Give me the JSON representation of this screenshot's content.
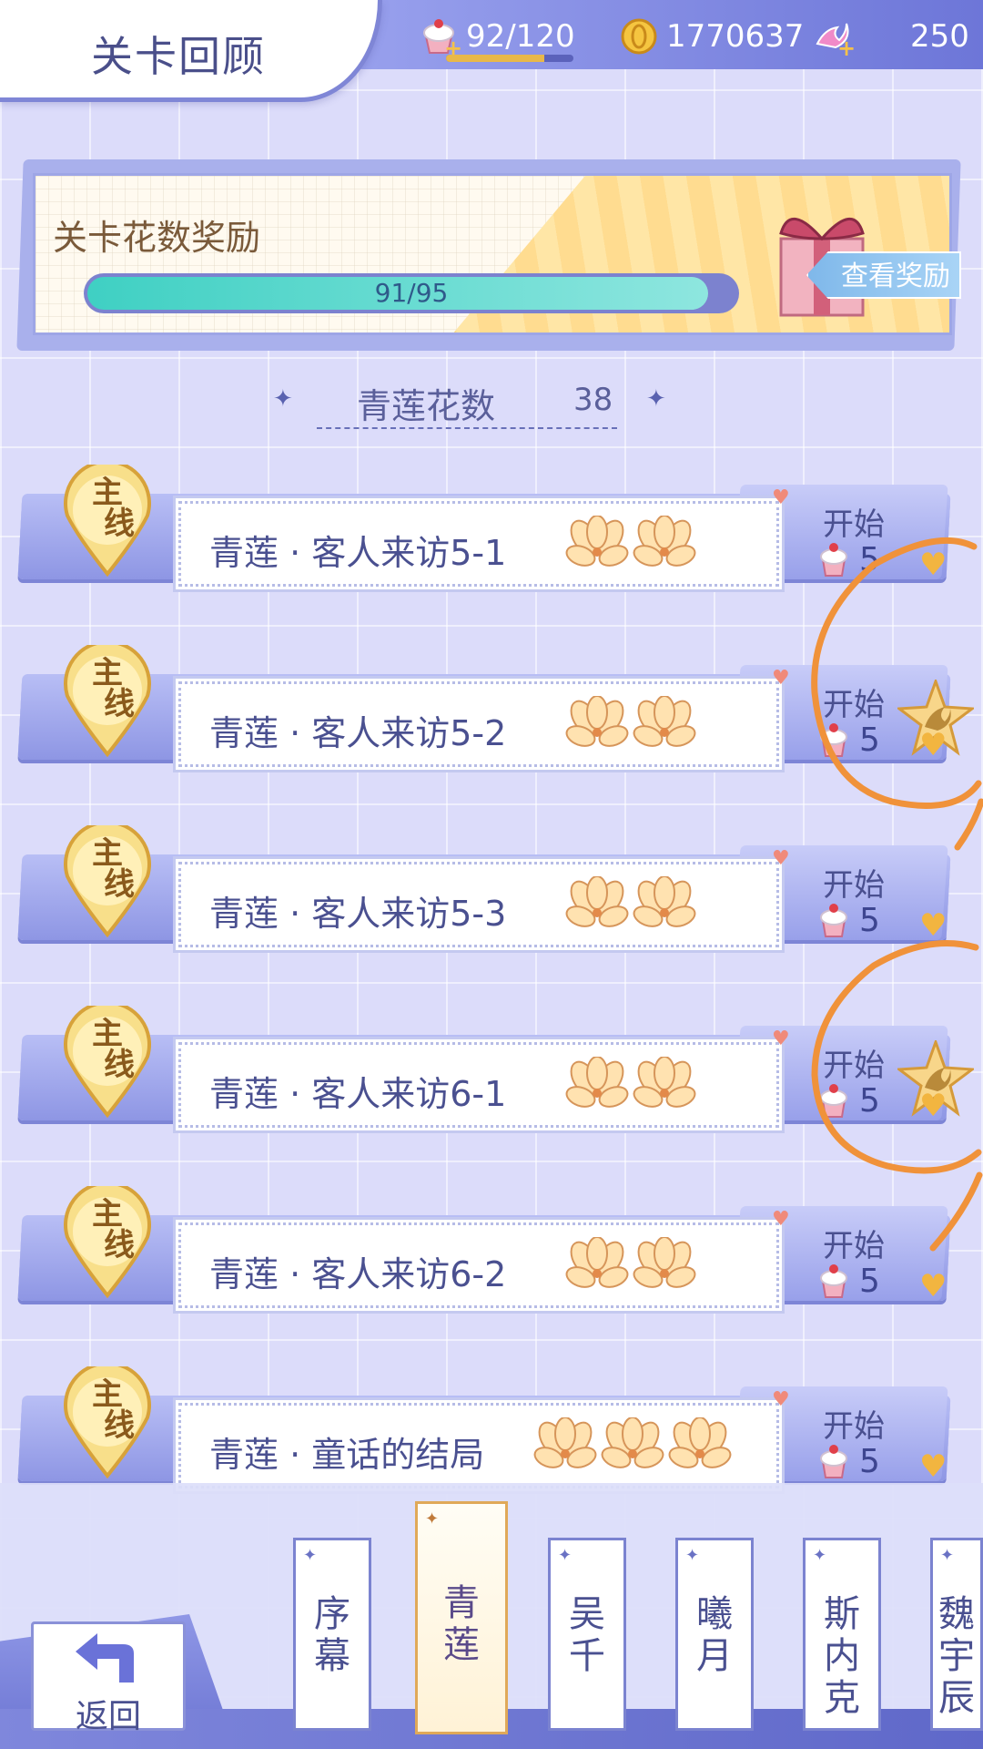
{
  "header": {
    "title": "关卡回顾",
    "resources": {
      "stamina": "92/120",
      "stamina_fraction": 0.77,
      "gold": "1770637",
      "gems": "250"
    }
  },
  "reward": {
    "title": "关卡花数奖励",
    "progress_text": "91/95",
    "progress_fraction": 0.958,
    "view_button": "查看奖励"
  },
  "flower_count": {
    "label": "青莲花数",
    "value": "38"
  },
  "levels": [
    {
      "badge_top": "主",
      "badge_bottom": "线",
      "name": "青莲 · 客人来访5-1",
      "flowers": 2,
      "start": "开始",
      "cost": "5",
      "star": false
    },
    {
      "badge_top": "主",
      "badge_bottom": "线",
      "name": "青莲 · 客人来访5-2",
      "flowers": 2,
      "start": "开始",
      "cost": "5",
      "star": true
    },
    {
      "badge_top": "主",
      "badge_bottom": "线",
      "name": "青莲 · 客人来访5-3",
      "flowers": 2,
      "start": "开始",
      "cost": "5",
      "star": false
    },
    {
      "badge_top": "主",
      "badge_bottom": "线",
      "name": "青莲 · 客人来访6-1",
      "flowers": 2,
      "start": "开始",
      "cost": "5",
      "star": true
    },
    {
      "badge_top": "主",
      "badge_bottom": "线",
      "name": "青莲 · 客人来访6-2",
      "flowers": 2,
      "start": "开始",
      "cost": "5",
      "star": false
    },
    {
      "badge_top": "主",
      "badge_bottom": "线",
      "name": "青莲 · 童话的结局",
      "flowers": 3,
      "start": "开始",
      "cost": "5",
      "star": false
    }
  ],
  "bottom": {
    "back_label": "返回",
    "chapters": [
      {
        "label": "序幕",
        "active": false
      },
      {
        "label": "青莲",
        "active": true
      },
      {
        "label": "吴千",
        "active": false
      },
      {
        "label": "曦月",
        "active": false
      },
      {
        "label": "斯内克",
        "active": false
      },
      {
        "label": "魏宇辰",
        "active": false
      }
    ]
  },
  "colors": {
    "background": "#dcdcfa",
    "accent": "#6d76d8",
    "annotation": "#f0923a",
    "progress": "#3fd0c3"
  }
}
